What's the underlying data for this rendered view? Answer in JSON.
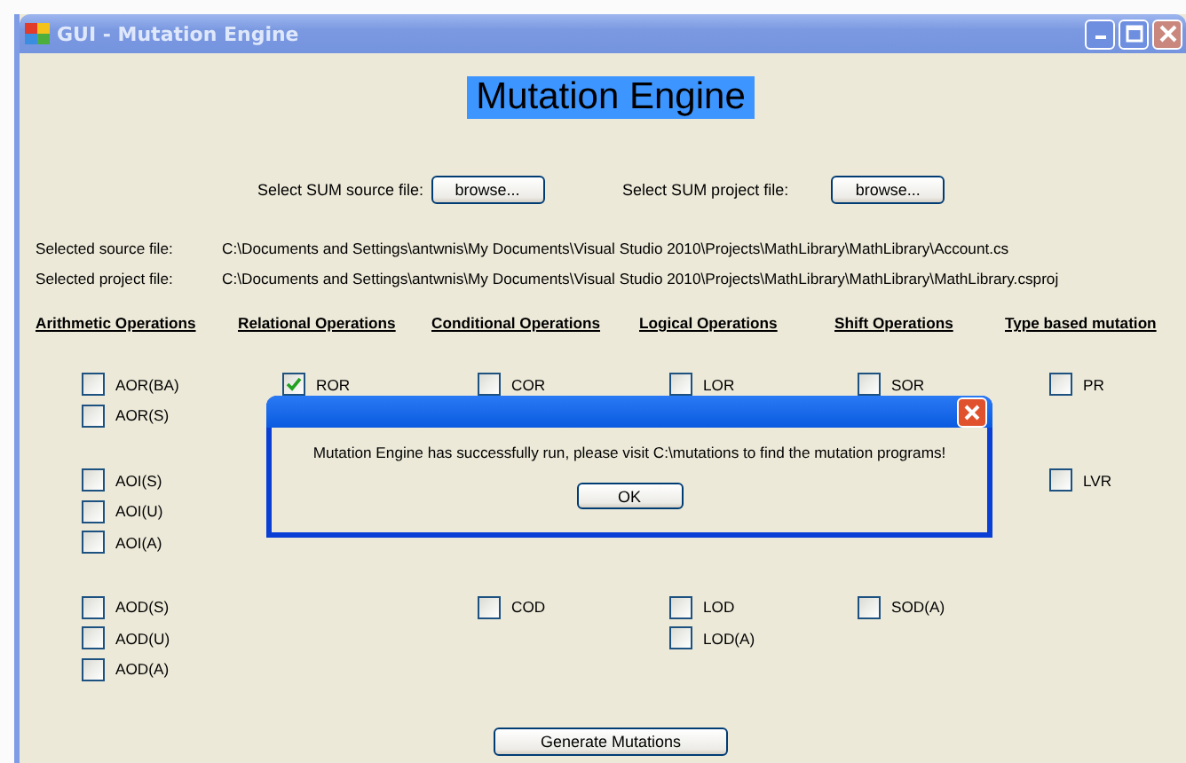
{
  "window": {
    "title": "GUI - Mutation Engine"
  },
  "heading": "Mutation Engine",
  "file_pickers": [
    {
      "label": "Select SUM source file:",
      "button": "browse..."
    },
    {
      "label": "Select SUM project file:",
      "button": "browse..."
    }
  ],
  "selected_files": [
    {
      "label": "Selected source file:",
      "path": "C:\\Documents and Settings\\antwnis\\My Documents\\Visual Studio 2010\\Projects\\MathLibrary\\MathLibrary\\Account.cs"
    },
    {
      "label": "Selected project file:",
      "path": "C:\\Documents and Settings\\antwnis\\My Documents\\Visual Studio 2010\\Projects\\MathLibrary\\MathLibrary\\MathLibrary.csproj"
    }
  ],
  "column_headings": [
    "Arithmetic Operations",
    "Relational Operations",
    "Conditional Operations",
    "Logical Operations",
    "Shift Operations",
    "Type based mutation"
  ],
  "option_sections": [
    [
      {
        "arithmetic": {
          "label": "AOR(BA)",
          "checked": false
        },
        "relational": {
          "label": "ROR",
          "checked": true
        },
        "conditional": {
          "label": "COR",
          "checked": false
        },
        "logical": {
          "label": "LOR",
          "checked": false
        },
        "shift": {
          "label": "SOR",
          "checked": false
        },
        "type_based": {
          "label": "PR",
          "checked": false
        }
      },
      {
        "arithmetic": {
          "label": "AOR(S)",
          "checked": false
        }
      }
    ],
    [
      {
        "arithmetic": {
          "label": "AOI(S)",
          "checked": false
        },
        "type_based": {
          "label": "LVR",
          "checked": false
        }
      },
      {
        "arithmetic": {
          "label": "AOI(U)",
          "checked": false
        }
      },
      {
        "arithmetic": {
          "label": "AOI(A)",
          "checked": false
        }
      }
    ],
    [
      {
        "arithmetic": {
          "label": "AOD(S)",
          "checked": false
        },
        "conditional": {
          "label": "COD",
          "checked": false
        },
        "logical": {
          "label": "LOD",
          "checked": false
        },
        "shift": {
          "label": "SOD(A)",
          "checked": false
        }
      },
      {
        "arithmetic": {
          "label": "AOD(U)",
          "checked": false
        },
        "logical": {
          "label": "LOD(A)",
          "checked": false
        }
      },
      {
        "arithmetic": {
          "label": "AOD(A)",
          "checked": false
        }
      }
    ]
  ],
  "generate_button": "Generate Mutations",
  "dialog": {
    "message": "Mutation Engine has successfully run, please visit C:\\mutations to find the mutation programs!",
    "button": "OK"
  }
}
